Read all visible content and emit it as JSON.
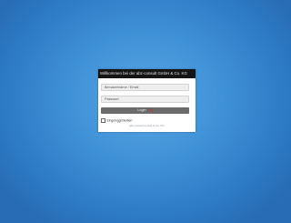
{
  "login": {
    "title": "Willkommen bei der abz-consult GmbH & Co. KG",
    "username_placeholder": "Benutzername / Email",
    "password_placeholder": "Passwort",
    "login_label": "Login",
    "remember_label": "Eingeloggt bleiben",
    "footer": "abz-consult GmbH & Co. KG"
  },
  "colors": {
    "background": "#3e90d6",
    "titlebar": "#151515",
    "button": "#6b6b6b",
    "login_icon": "#c0392b"
  },
  "icons": {
    "login_icon": "login-arrow-icon"
  }
}
